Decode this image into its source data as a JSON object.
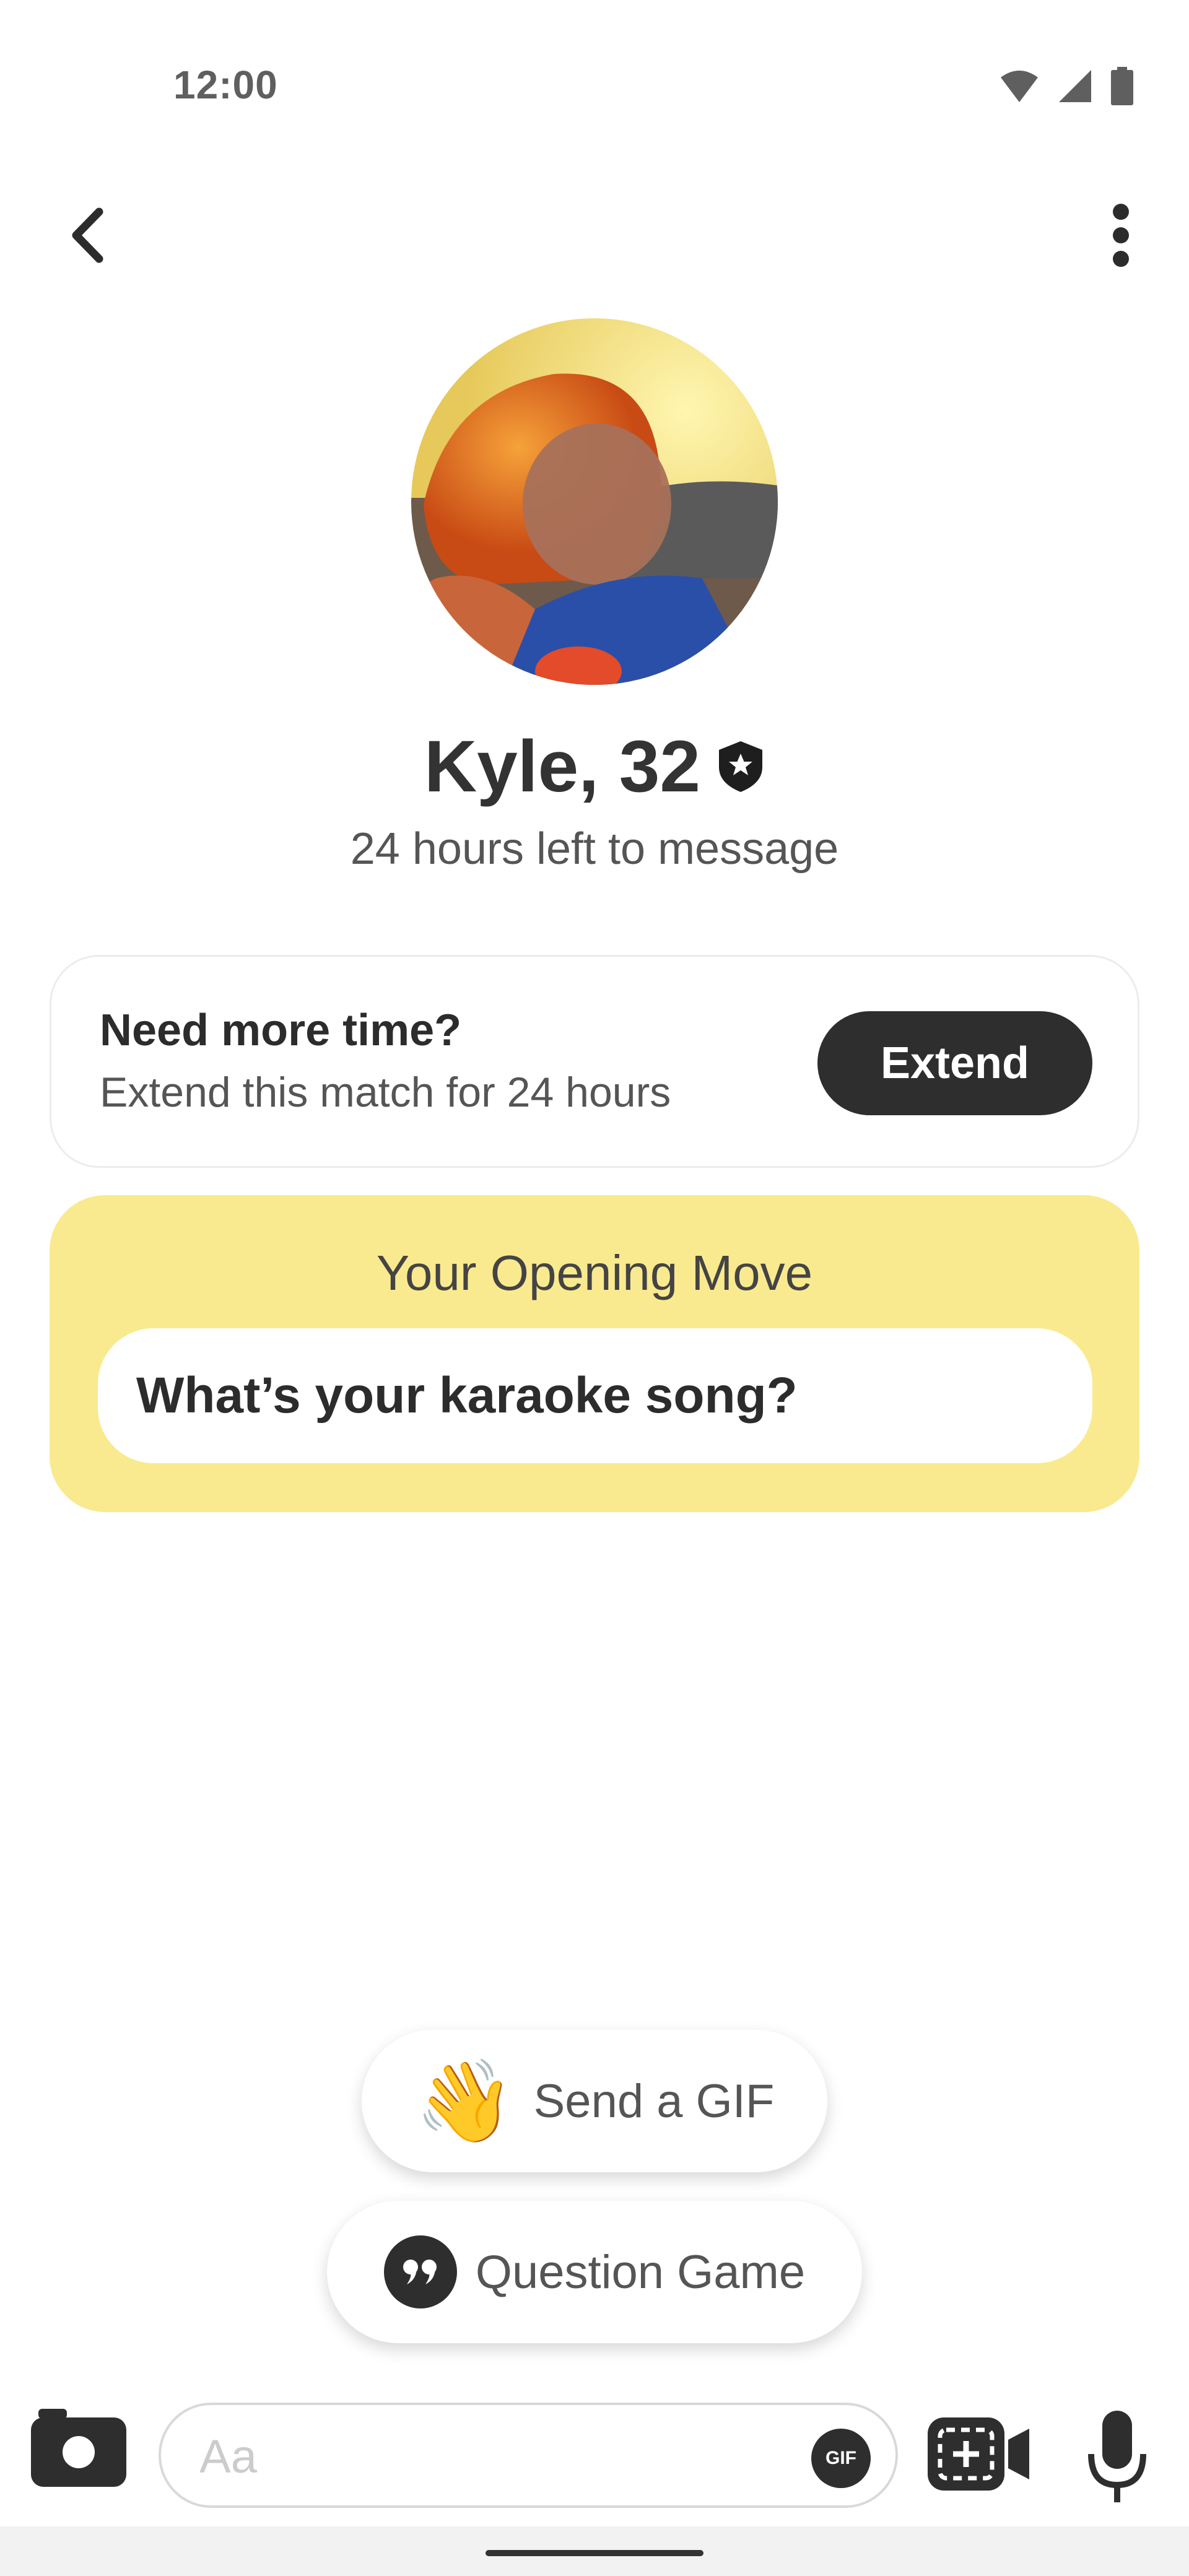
{
  "status_bar": {
    "time": "12:00",
    "icons": [
      "wifi-icon",
      "signal-icon",
      "battery-icon"
    ]
  },
  "top_bar": {
    "back_icon": "chevron-left-icon",
    "more_icon": "more-vertical-icon"
  },
  "profile": {
    "name": "Kyle, 32",
    "verified_icon": "verified-badge-icon",
    "time_left": "24 hours left to message"
  },
  "extend_card": {
    "title": "Need more time?",
    "subtitle": "Extend this match for 24 hours",
    "button_label": "Extend"
  },
  "opening_move": {
    "title": "Your Opening Move",
    "question": "What’s your karaoke song?",
    "background_color": "#faea8f"
  },
  "suggestions": {
    "gif_emoji": "👋",
    "gif_label": "Send a GIF",
    "question_icon": "quote-icon",
    "question_label": "Question Game"
  },
  "composer": {
    "placeholder": "Aa",
    "gif_badge": "GIF",
    "camera_icon": "camera-icon",
    "video_icon": "video-call-icon",
    "mic_icon": "microphone-icon"
  }
}
